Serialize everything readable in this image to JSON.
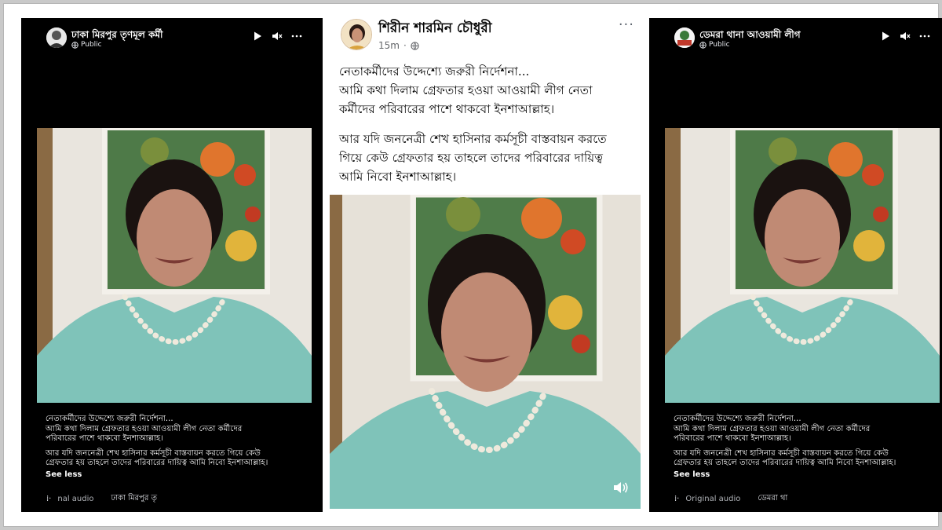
{
  "left_reel": {
    "page_name": "ঢাকা মিরপুর তৃণমূল কর্মী",
    "audience": "Public",
    "caption_line1": "নেতাকর্মীদের উদ্দেশ্যে জরুরী নির্দেশনা...",
    "caption_line2": "আমি কথা দিলাম গ্রেফতার হওয়া আওয়ামী লীগ নেতা কর্মীদের",
    "caption_line3": "পরিবারের পাশে থাকবো ইনশাআল্লাহ।",
    "caption_line4": "আর যদি জননেত্রী শেখ হাসিনার কর্মসূচী বাস্তবায়ন করতে গিয়ে কেউ",
    "caption_line5": "গ্রেফতার হয় তাহলে তাদের পরিবারের দায়িত্ব আমি নিবো ইনশাআল্লাহ।",
    "see_less": "See less",
    "audio_label": "nal audio",
    "audio_page": "ঢাকা মিরপুর তৃ"
  },
  "post": {
    "author": "শিরীন শারমিন চৌধুরী",
    "time": "15m",
    "more": "···",
    "line1": "নেতাকর্মীদের উদ্দেশ্যে জরুরী নির্দেশনা...",
    "line2": "আমি কথা দিলাম গ্রেফতার হওয়া আওয়ামী লীগ নেতা",
    "line3": "কর্মীদের পরিবারের পাশে থাকবো ইনশাআল্লাহ।",
    "line4": "আর যদি জননেত্রী শেখ হাসিনার কর্মসূচী বাস্তবায়ন করতে",
    "line5": "গিয়ে কেউ গ্রেফতার হয় তাহলে তাদের পরিবারের দায়িত্ব",
    "line6": "আমি নিবো ইনশাআল্লাহ।"
  },
  "right_reel": {
    "page_name": "ডেমরা থানা আওয়ামী লীগ",
    "audience": "Public",
    "caption_line1": "নেতাকর্মীদের উদ্দেশ্যে জরুরী নির্দেশনা...",
    "caption_line2": "আমি কথা দিলাম গ্রেফতার হওয়া আওয়ামী লীগ নেতা কর্মীদের",
    "caption_line3": "পরিবারের পাশে থাকবো ইনশাআল্লাহ।",
    "caption_line4": "আর যদি জননেত্রী শেখ হাসিনার কর্মসূচী বাস্তবায়ন করতে গিয়ে কেউ",
    "caption_line5": "গ্রেফতার হয় তাহলে তাদের পরিবারের দায়িত্ব আমি নিবো ইনশাআল্লাহ।",
    "see_less": "See less",
    "audio_label": "Original audio",
    "audio_page": "ডেমরা থা"
  },
  "colors": {
    "reel_background": "#000000",
    "post_background": "#ffffff",
    "secondary_text": "#65676b",
    "saree_teal": "#7fc3b9"
  }
}
